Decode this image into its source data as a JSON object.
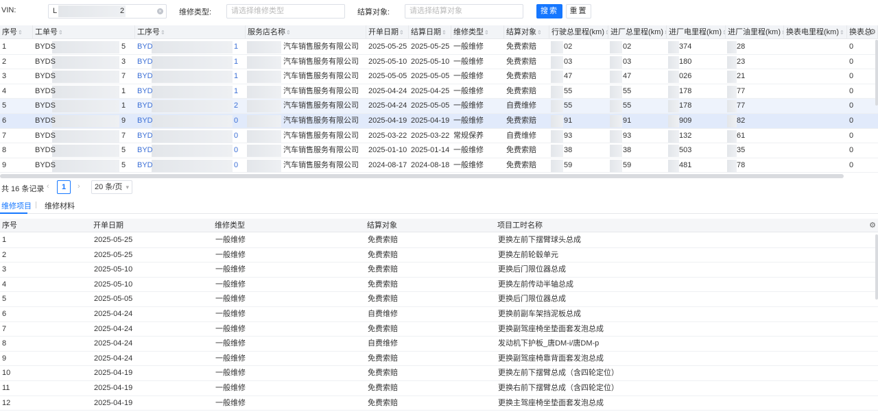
{
  "filters": {
    "vin_label": "VIN:",
    "vin_value_start": "L",
    "vin_value_end": "2",
    "repair_type_label": "维修类型:",
    "repair_type_placeholder": "请选择维修类型",
    "settle_label": "结算对象:",
    "settle_placeholder": "请选择结算对象",
    "search_button": "搜索",
    "reset_button": "重置"
  },
  "top_table": {
    "columns": [
      "序号",
      "工单号",
      "工序号",
      "服务店名称",
      "开单日期",
      "结算日期",
      "维修类型",
      "结算对象",
      "行驶总里程(km)",
      "进厂总里程(km)",
      "进厂电里程(km)",
      "进厂油里程(km)",
      "换表电里程(km)",
      "换表总"
    ],
    "rows": [
      {
        "no": "1",
        "order": "BYDS",
        "order_end": "5",
        "proc": "BYD",
        "proc_end": "1",
        "store": "汽车销售服务有限公司",
        "open": "2025-05-25",
        "settle": "2025-05-25",
        "type": "一般维修",
        "obj": "免费索赔",
        "total": "02",
        "in_total": "02",
        "in_ev": "374",
        "in_oil": "28",
        "sw_ev": "0"
      },
      {
        "no": "2",
        "order": "BYDS",
        "order_end": "3",
        "proc": "BYD",
        "proc_end": "1",
        "store": "汽车销售服务有限公司",
        "open": "2025-05-10",
        "settle": "2025-05-10",
        "type": "一般维修",
        "obj": "免费索赔",
        "total": "03",
        "in_total": "03",
        "in_ev": "180",
        "in_oil": "23",
        "sw_ev": "0"
      },
      {
        "no": "3",
        "order": "BYDS",
        "order_end": "7",
        "proc": "BYD",
        "proc_end": "1",
        "store": "汽车销售服务有限公司",
        "open": "2025-05-05",
        "settle": "2025-05-05",
        "type": "一般维修",
        "obj": "免费索赔",
        "total": "47",
        "in_total": "47",
        "in_ev": "026",
        "in_oil": "21",
        "sw_ev": "0"
      },
      {
        "no": "4",
        "order": "BYDS",
        "order_end": "1",
        "proc": "BYD",
        "proc_end": "1",
        "store": "汽车销售服务有限公司",
        "open": "2025-04-24",
        "settle": "2025-04-25",
        "type": "一般维修",
        "obj": "免费索赔",
        "total": "55",
        "in_total": "55",
        "in_ev": "178",
        "in_oil": "77",
        "sw_ev": "0"
      },
      {
        "no": "5",
        "order": "BYDS",
        "order_end": "1",
        "proc": "BYD",
        "proc_end": "2",
        "store": "汽车销售服务有限公司",
        "open": "2025-04-24",
        "settle": "2025-05-05",
        "type": "一般维修",
        "obj": "自费维修",
        "total": "55",
        "in_total": "55",
        "in_ev": "178",
        "in_oil": "77",
        "sw_ev": "0"
      },
      {
        "no": "6",
        "order": "BYDS",
        "order_end": "9",
        "proc": "BYD",
        "proc_end": "0",
        "store": "汽车销售服务有限公司",
        "open": "2025-04-19",
        "settle": "2025-04-19",
        "type": "一般维修",
        "obj": "免费索赔",
        "total": "91",
        "in_total": "91",
        "in_ev": "909",
        "in_oil": "82",
        "sw_ev": "0"
      },
      {
        "no": "7",
        "order": "BYDS",
        "order_end": "7",
        "proc": "BYD",
        "proc_end": "0",
        "store": "汽车销售服务有限公司",
        "open": "2025-03-22",
        "settle": "2025-03-22",
        "type": "常规保养",
        "obj": "自费维修",
        "total": "93",
        "in_total": "93",
        "in_ev": "132",
        "in_oil": "61",
        "sw_ev": "0"
      },
      {
        "no": "8",
        "order": "BYDS",
        "order_end": "5",
        "proc": "BYD",
        "proc_end": "0",
        "store": "汽车销售服务有限公司",
        "open": "2025-01-10",
        "settle": "2025-01-14",
        "type": "一般维修",
        "obj": "免费索赔",
        "total": "38",
        "in_total": "38",
        "in_ev": "503",
        "in_oil": "35",
        "sw_ev": "0"
      },
      {
        "no": "9",
        "order": "BYDS",
        "order_end": "5",
        "proc": "BYD",
        "proc_end": "0",
        "store": "汽车销售服务有限公司",
        "open": "2024-08-17",
        "settle": "2024-08-18",
        "type": "一般维修",
        "obj": "免费索赔",
        "total": "59",
        "in_total": "59",
        "in_ev": "481",
        "in_oil": "78",
        "sw_ev": "0"
      }
    ]
  },
  "pager": {
    "total": "共 16 条记录",
    "prev": "‹",
    "current": "1",
    "next": "›",
    "size": "20 条/页",
    "size_chevron": "▾"
  },
  "tabs": [
    "维修项目",
    "维修材料"
  ],
  "bottom_table": {
    "columns": [
      "序号",
      "开单日期",
      "维修类型",
      "结算对象",
      "项目工时名称"
    ],
    "rows": [
      {
        "no": "1",
        "date": "2025-05-25",
        "type": "一般维修",
        "obj": "免费索赔",
        "name": "更换左前下摆臂球头总成"
      },
      {
        "no": "2",
        "date": "2025-05-25",
        "type": "一般维修",
        "obj": "免费索赔",
        "name": "更换左前轮毂单元"
      },
      {
        "no": "3",
        "date": "2025-05-10",
        "type": "一般维修",
        "obj": "免费索赔",
        "name": "更换后门限位器总成"
      },
      {
        "no": "4",
        "date": "2025-05-10",
        "type": "一般维修",
        "obj": "免费索赔",
        "name": "更换左前传动半轴总成"
      },
      {
        "no": "5",
        "date": "2025-05-05",
        "type": "一般维修",
        "obj": "免费索赔",
        "name": "更换后门限位器总成"
      },
      {
        "no": "6",
        "date": "2025-04-24",
        "type": "一般维修",
        "obj": "自费维修",
        "name": "更换前副车架挡泥板总成"
      },
      {
        "no": "7",
        "date": "2025-04-24",
        "type": "一般维修",
        "obj": "免费索赔",
        "name": "更换副驾座椅坐垫面套发泡总成"
      },
      {
        "no": "8",
        "date": "2025-04-24",
        "type": "一般维修",
        "obj": "自费维修",
        "name": "发动机下护板_唐DM-i/唐DM-p"
      },
      {
        "no": "9",
        "date": "2025-04-24",
        "type": "一般维修",
        "obj": "免费索赔",
        "name": "更换副驾座椅靠背面套发泡总成"
      },
      {
        "no": "10",
        "date": "2025-04-19",
        "type": "一般维修",
        "obj": "免费索赔",
        "name": "更换左前下摆臂总成（含四轮定位）"
      },
      {
        "no": "11",
        "date": "2025-04-19",
        "type": "一般维修",
        "obj": "免费索赔",
        "name": "更换右前下摆臂总成（含四轮定位）"
      },
      {
        "no": "12",
        "date": "2025-04-19",
        "type": "一般维修",
        "obj": "免费索赔",
        "name": "更换主驾座椅坐垫面套发泡总成"
      }
    ]
  },
  "icons": {
    "clear": "circle-x",
    "settings": "gear",
    "sort": "sort-arrows"
  },
  "colors": {
    "primary": "#1677ff",
    "link": "#3b6fd6",
    "header_bg": "#f2f4f7",
    "selected_row": "#e1eafb"
  }
}
